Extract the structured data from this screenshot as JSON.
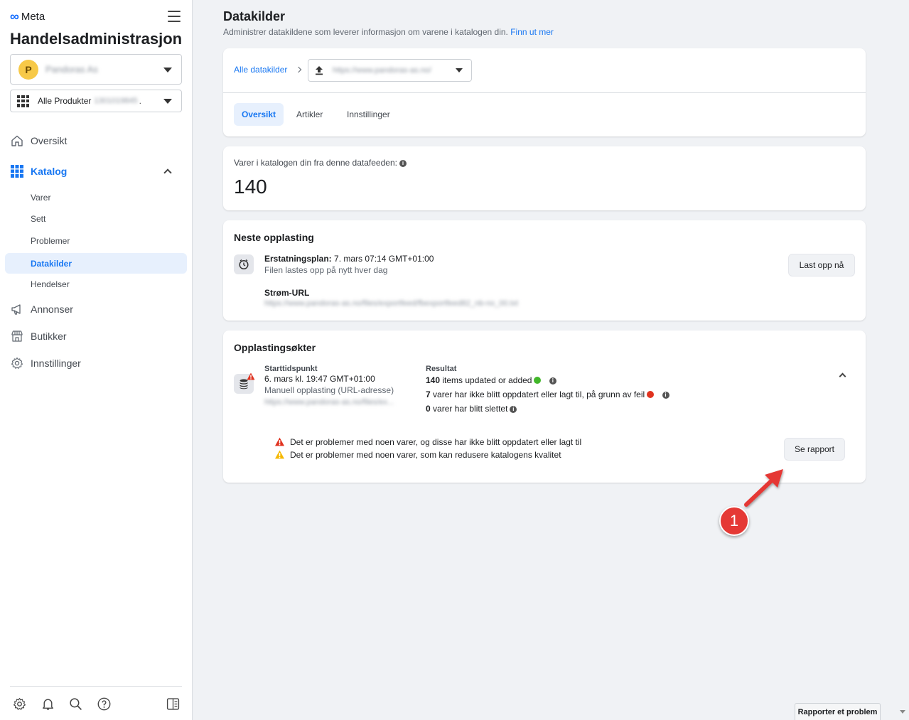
{
  "sidebar": {
    "brand": "Meta",
    "app_title": "Handelsadministrasjon",
    "account": {
      "avatar_letter": "P",
      "name": "Pandoras As"
    },
    "catalog": {
      "label": "Alle Produkter",
      "id": "1301019845",
      "ellipsis": "."
    },
    "nav": {
      "oversikt": "Oversikt",
      "katalog": "Katalog",
      "katalog_items": {
        "varer": "Varer",
        "sett": "Sett",
        "problemer": "Problemer",
        "datakilder": "Datakilder",
        "hendelser": "Hendelser"
      },
      "annonser": "Annonser",
      "butikker": "Butikker",
      "innstillinger": "Innstillinger"
    }
  },
  "header": {
    "title": "Datakilder",
    "subtitle": "Administrer datakildene som leverer informasjon om varene i katalogen din.",
    "learn_more": "Finn ut mer"
  },
  "source_card": {
    "breadcrumb_root": "Alle datakilder",
    "source_url": "https://www.pandoras-as.no/",
    "tabs": [
      "Oversikt",
      "Artikler",
      "Innstillinger"
    ]
  },
  "count_card": {
    "label": "Varer i katalogen din fra denne datafeeden:",
    "value": "140"
  },
  "next_upload": {
    "title": "Neste opplasting",
    "schedule_label": "Erstatningsplan:",
    "schedule_value": "7. mars 07:14 GMT+01:00",
    "frequency": "Filen lastes opp på nytt hver dag",
    "feed_url_label": "Strøm-URL",
    "feed_url": "https://www.pandoras-as.no/files/exportfeed/fbexportfeed82_nb-no_00.txt",
    "upload_now_button": "Last opp nå"
  },
  "sessions": {
    "title": "Opplastingsøkter",
    "start_label": "Starttidspunkt",
    "start_value": "6. mars kl. 19:47 GMT+01:00",
    "method": "Manuell opplasting (URL-adresse)",
    "url": "https://www.pandoras-as.no/files/ex...",
    "result_label": "Resultat",
    "result_updated_count": "140",
    "result_updated_text": "items updated or added",
    "result_failed_count": "7",
    "result_failed_text": "varer har ikke blitt oppdatert eller lagt til, på grunn av feil",
    "result_deleted_count": "0",
    "result_deleted_text": "varer har blitt slettet",
    "error_message": "Det er problemer med noen varer, og disse har ikke blitt oppdatert eller lagt til",
    "warning_message": "Det er problemer med noen varer, som kan redusere katalogens kvalitet",
    "report_button": "Se rapport"
  },
  "annotation": {
    "badge": "1"
  },
  "footer": {
    "report_problem": "Rapporter et problem"
  },
  "colors": {
    "accent": "#1877f2",
    "success": "#42b72a",
    "error": "#e0321f",
    "warning": "#f5b800",
    "annotation": "#e53935"
  }
}
